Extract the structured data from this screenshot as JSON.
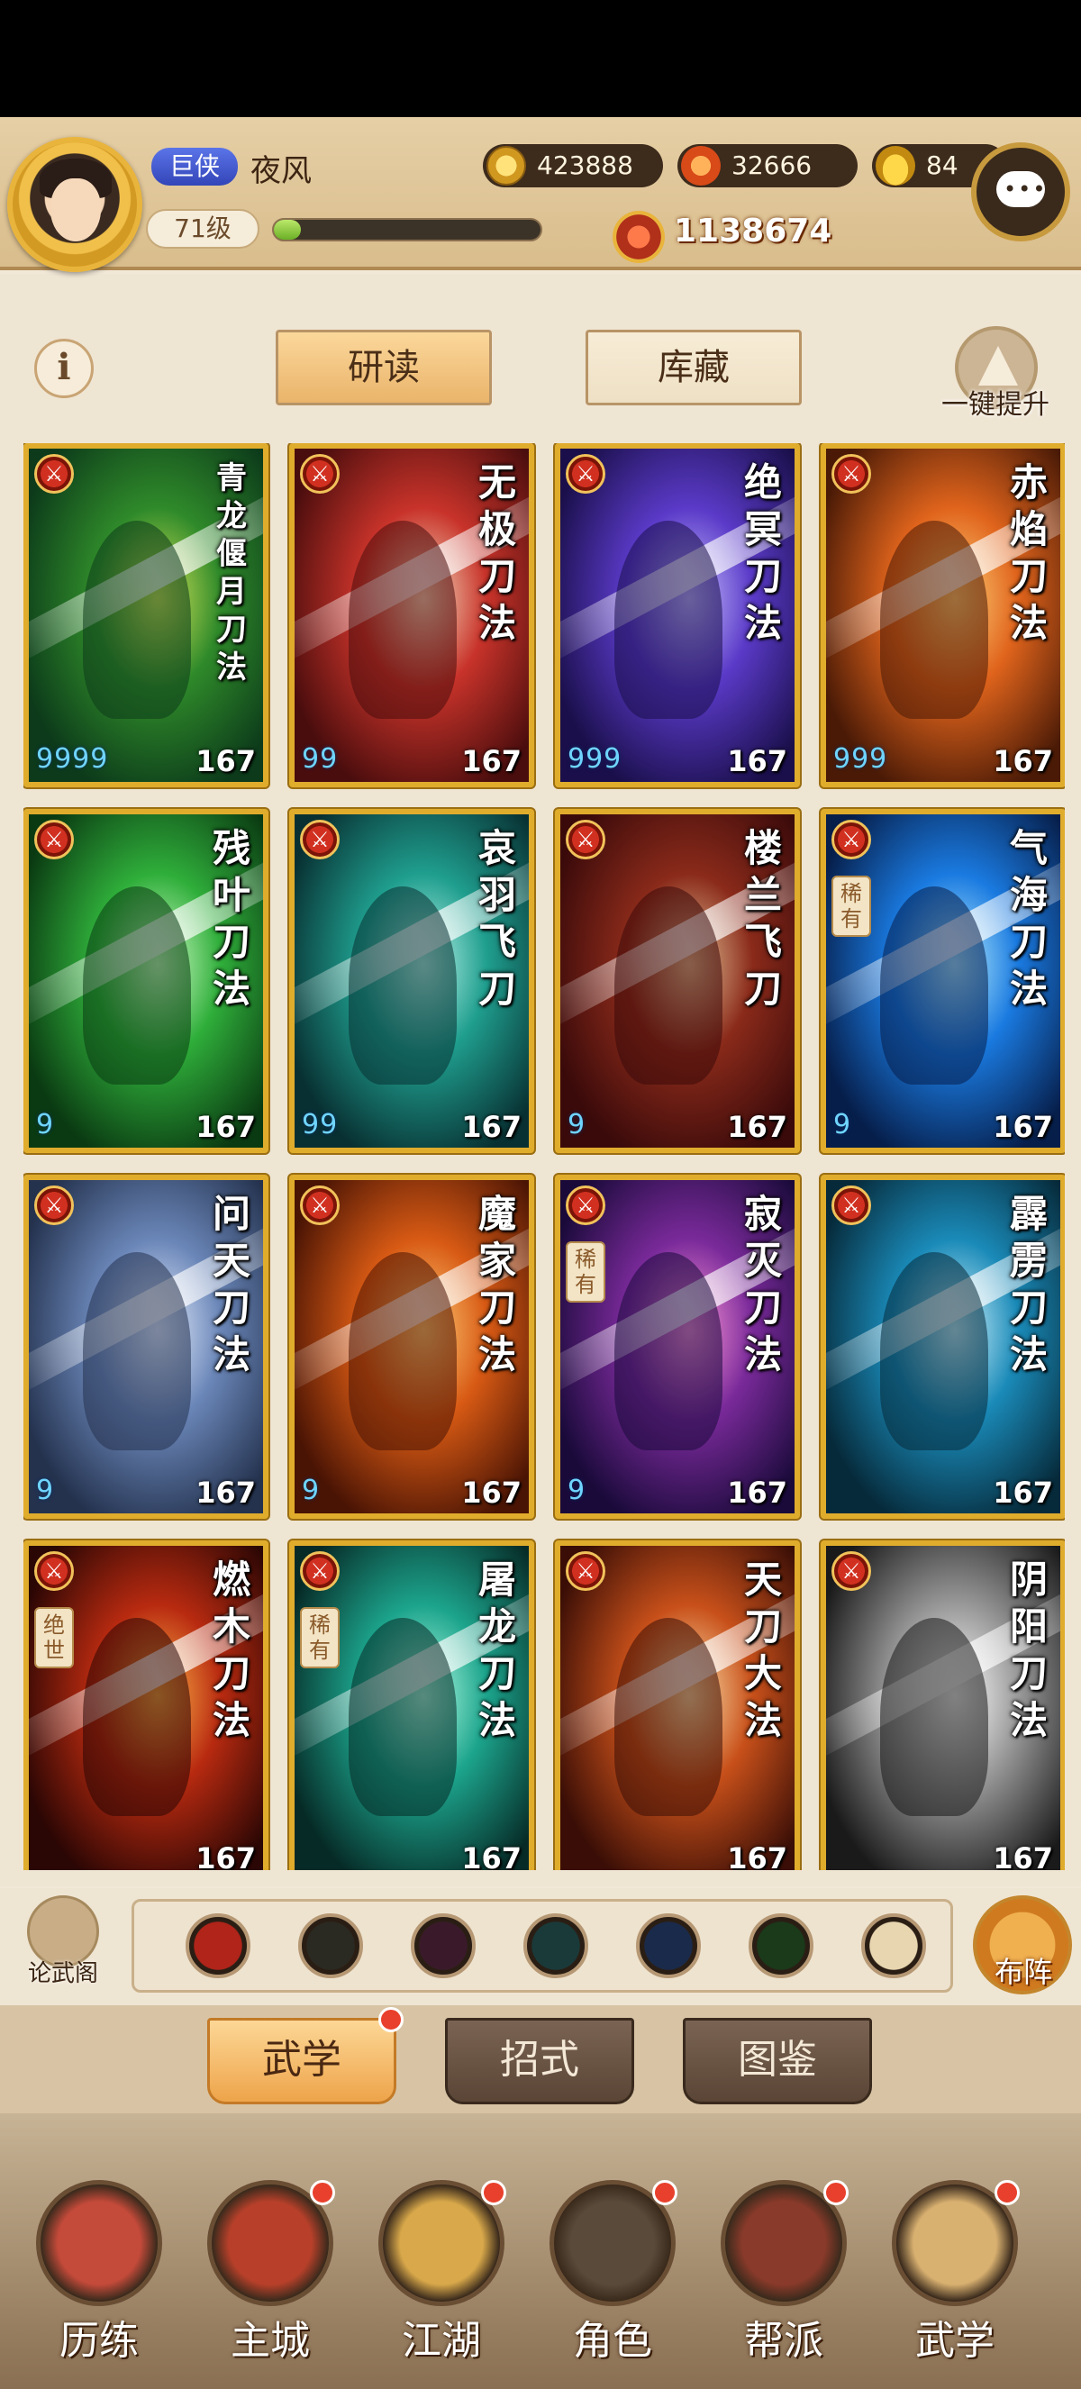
{
  "player": {
    "rank_title": "巨侠",
    "name": "夜风",
    "level": "71级",
    "xp_fraction": 0.1
  },
  "resources": {
    "copper": "423888",
    "flame": "32666",
    "ingot": "84"
  },
  "power": "1138674",
  "top_tabs": {
    "study": "研读",
    "storage": "库藏"
  },
  "upgrade_all_label": "一键提升",
  "cards": [
    {
      "title": "青龙偃月刀法",
      "level": "167",
      "dots": "9999",
      "colors": [
        "#0c3a1a",
        "#2f8a2a",
        "#d8e65a"
      ]
    },
    {
      "title": "无极刀法",
      "level": "167",
      "dots": "99",
      "colors": [
        "#4a0d0d",
        "#c8332a",
        "#f6e2c4"
      ]
    },
    {
      "title": "绝冥刀法",
      "level": "167",
      "dots": "999",
      "colors": [
        "#1a0f4a",
        "#5a3ac8",
        "#c9c2ff"
      ]
    },
    {
      "title": "赤焰刀法",
      "level": "167",
      "dots": "999",
      "colors": [
        "#4a1a06",
        "#e0641c",
        "#ffd27a"
      ]
    },
    {
      "title": "残叶刀法",
      "level": "167",
      "dots": "9",
      "colors": [
        "#0a3a12",
        "#2fae3a",
        "#d6ffcc"
      ]
    },
    {
      "title": "哀羽飞刀",
      "level": "167",
      "dots": "99",
      "colors": [
        "#083032",
        "#1f9e8e",
        "#bff6ec"
      ]
    },
    {
      "title": "楼兰飞刀",
      "level": "167",
      "dots": "9",
      "colors": [
        "#3a0a0a",
        "#8a2a1a",
        "#e6c69a"
      ]
    },
    {
      "title": "气海刀法",
      "level": "167",
      "dots": "9",
      "tag": "稀有",
      "colors": [
        "#061e4a",
        "#1a7ae0",
        "#b8f0ff"
      ]
    },
    {
      "title": "问天刀法",
      "level": "167",
      "dots": "9",
      "colors": [
        "#24324e",
        "#6a86b8",
        "#e8f0ff"
      ]
    },
    {
      "title": "魔家刀法",
      "level": "167",
      "dots": "9",
      "colors": [
        "#4a1404",
        "#d85a14",
        "#ffd07a"
      ]
    },
    {
      "title": "寂灭刀法",
      "level": "167",
      "dots": "9",
      "tag": "稀有",
      "colors": [
        "#1a0a3a",
        "#7a2a9a",
        "#ff9ad8"
      ]
    },
    {
      "title": "霹雳刀法",
      "level": "167",
      "dots": "",
      "colors": [
        "#062a3a",
        "#1a8ab8",
        "#d6f6ff"
      ]
    },
    {
      "title": "燃木刀法",
      "level": "167",
      "dots": "",
      "tag": "绝世",
      "colors": [
        "#2a0604",
        "#b82a10",
        "#ffb64a"
      ]
    },
    {
      "title": "屠龙刀法",
      "level": "167",
      "dots": "",
      "tag": "稀有",
      "colors": [
        "#062a26",
        "#1ca48c",
        "#b8ffe6"
      ]
    },
    {
      "title": "天刀大法",
      "level": "167",
      "dots": "",
      "colors": [
        "#3a0e06",
        "#c8501a",
        "#ffe6b0"
      ]
    },
    {
      "title": "阴阳刀法",
      "level": "167",
      "dots": "",
      "colors": [
        "#1a1a1a",
        "#9a9a9a",
        "#ffffff"
      ]
    }
  ],
  "formation": {
    "left_label": "论武阁",
    "right_label": "布阵",
    "slot_colors": [
      "#b0241a",
      "#2a2a22",
      "#3a1a2a",
      "#1a3a3a",
      "#1a2a4a",
      "#1a3a1a",
      "#e8d6b0"
    ]
  },
  "sub_tabs": {
    "martial": "武学",
    "moves": "招式",
    "atlas": "图鉴"
  },
  "nav": [
    {
      "label": "历练",
      "color": "#c44a3a"
    },
    {
      "label": "主城",
      "color": "#b8402a"
    },
    {
      "label": "江湖",
      "color": "#d8a84a"
    },
    {
      "label": "角色",
      "color": "#5a4a3a"
    },
    {
      "label": "帮派",
      "color": "#8a3a2a"
    },
    {
      "label": "武学",
      "color": "#d8b070"
    }
  ]
}
